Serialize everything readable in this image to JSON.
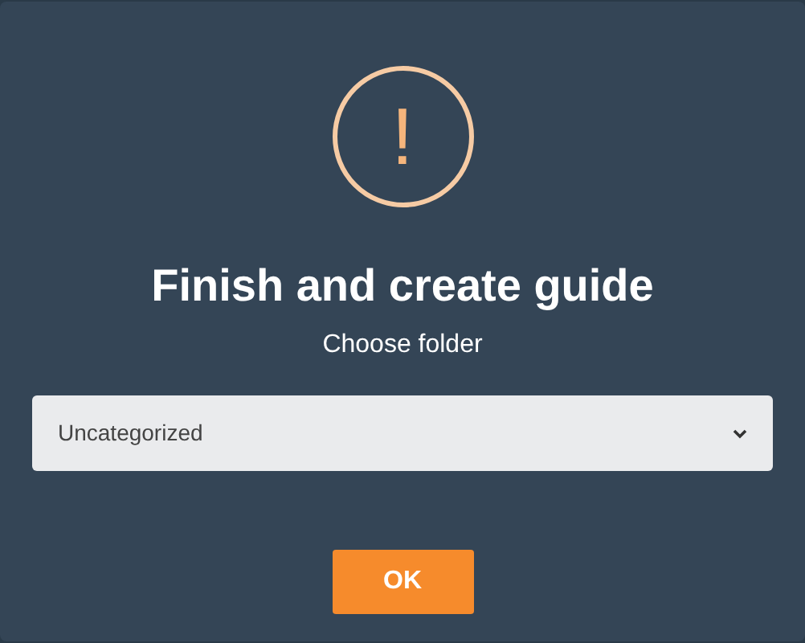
{
  "dialog": {
    "icon": "!",
    "title": "Finish and create guide",
    "subtitle": "Choose folder",
    "folder_select": {
      "value": "Uncategorized"
    },
    "buttons": [
      "OK"
    ]
  }
}
